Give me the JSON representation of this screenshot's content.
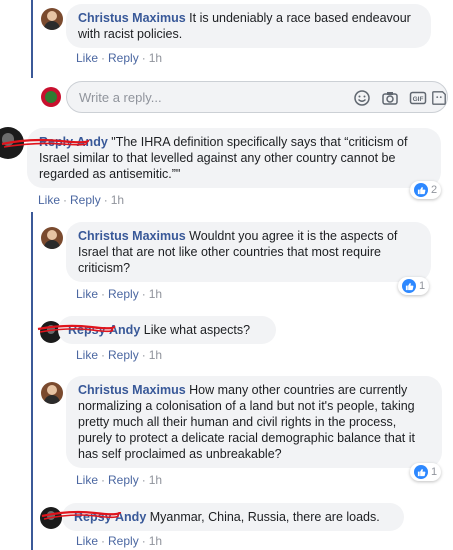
{
  "comments": [
    {
      "author": "Christus Maximus",
      "text": "It is undeniably a race based endeavour with racist policies.",
      "like": "Like",
      "reply": "Reply",
      "time": "1h"
    },
    {
      "author": "Andy",
      "struck_prefix": "Reply",
      "text": "\"The IHRA definition specifically says that “criticism of Israel similar to that levelled against any other country cannot be regarded as antisemitic.”\"",
      "like": "Like",
      "reply": "Reply",
      "time": "1h",
      "reactions": "2"
    },
    {
      "author": "Christus Maximus",
      "text": "Wouldnt you agree it is the aspects of Israel that are not like other countries that most require criticism?",
      "like": "Like",
      "reply": "Reply",
      "time": "1h",
      "reactions": "1"
    },
    {
      "author": "Andy",
      "struck_prefix": "Repsy",
      "text": "Like what aspects?",
      "like": "Like",
      "reply": "Reply",
      "time": "1h"
    },
    {
      "author": "Christus Maximus",
      "text": "How many other countries are currently normalizing a colonisation of a land but not it's people, taking pretty much all their human and civil rights in the process, purely to protect a delicate racial demographic balance that it has self proclaimed as unbreakable?",
      "like": "Like",
      "reply": "Reply",
      "time": "1h",
      "reactions": "1"
    },
    {
      "author": "Andy",
      "struck_prefix": "Repsy",
      "text": "Myanmar, China, Russia, there are loads.",
      "like": "Like",
      "reply": "Reply",
      "time": "1h"
    }
  ],
  "reply_box": {
    "placeholder": "Write a reply...",
    "icons": [
      "emoji-icon",
      "camera-icon",
      "gif-icon",
      "sticker-icon"
    ]
  },
  "colors": {
    "name": "#385898",
    "bubble": "#f2f3f5",
    "link": "#4b67a1",
    "thread_line": "#3b5998",
    "like_badge": "#2d88ff",
    "strike": "#e0141c"
  }
}
